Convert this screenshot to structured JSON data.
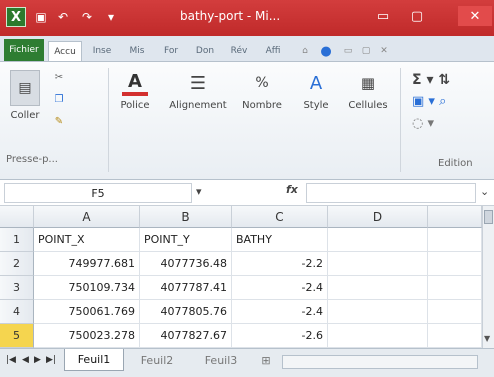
{
  "window": {
    "title": "bathy-port - Mi..."
  },
  "title_buttons": {
    "minimize": "▭",
    "maximize": "▢",
    "close": "✕"
  },
  "tabs": [
    "Fichier",
    "Accu",
    "Inse",
    "Mis",
    "For",
    "Don",
    "Rév",
    "Affi"
  ],
  "ribbon": {
    "clipboard": {
      "paste_label": "Coller",
      "group_label": "Presse-p..."
    },
    "police": "Police",
    "alignement": "Alignement",
    "nombre": "Nombre",
    "style": "Style",
    "cellules": "Cellules",
    "edition": "Edition"
  },
  "formula_bar": {
    "name_box": "F5",
    "fx": "fx",
    "formula": ""
  },
  "columns": [
    "A",
    "B",
    "C",
    "D"
  ],
  "rows": [
    {
      "n": "1",
      "a": "POINT_X",
      "b": "POINT_Y",
      "c": "BATHY"
    },
    {
      "n": "2",
      "a": "749977.681",
      "b": "4077736.48",
      "c": "-2.2"
    },
    {
      "n": "3",
      "a": "750109.734",
      "b": "4077787.41",
      "c": "-2.4"
    },
    {
      "n": "4",
      "a": "750061.769",
      "b": "4077805.76",
      "c": "-2.4"
    },
    {
      "n": "5",
      "a": "750023.278",
      "b": "4077827.67",
      "c": "-2.6"
    }
  ],
  "sheets": [
    "Feuil1",
    "Feuil2",
    "Feuil3"
  ],
  "colors": {
    "titlebar": "#c73232",
    "file_tab": "#2e7d32",
    "selected_row": "#f5d54f"
  },
  "icons": [
    "excel-logo",
    "save-icon",
    "undo-icon",
    "redo-icon",
    "paste-icon",
    "cut-icon",
    "copy-icon",
    "format-painter-icon",
    "font-icon",
    "align-icon",
    "percent-icon",
    "style-icon",
    "cells-icon",
    "sum-icon",
    "sort-icon",
    "fill-icon",
    "clear-icon",
    "help-icon"
  ]
}
